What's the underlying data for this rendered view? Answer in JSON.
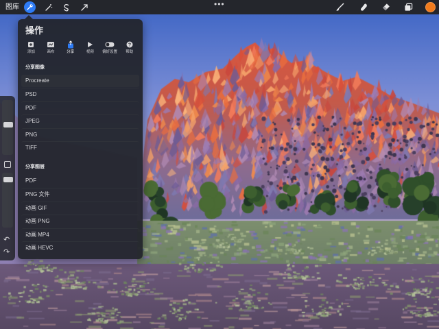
{
  "toolbar": {
    "gallery_label": "图库",
    "left_tools": [
      {
        "icon": "wrench-icon",
        "active": true
      },
      {
        "icon": "magic-wand-icon",
        "active": false
      },
      {
        "icon": "selection-icon",
        "active": false
      },
      {
        "icon": "transform-arrow-icon",
        "active": false
      }
    ],
    "more_label": "•••",
    "right_tools": [
      "brush-icon",
      "smudge-icon",
      "eraser-icon",
      "layers-icon"
    ],
    "current_color": "#f27b1c",
    "accent": "#2e7cf6"
  },
  "panel": {
    "title": "操作",
    "tabs": [
      {
        "label": "添加",
        "icon": "add-icon"
      },
      {
        "label": "画布",
        "icon": "canvas-icon"
      },
      {
        "label": "分享",
        "icon": "share-icon",
        "active": true
      },
      {
        "label": "视频",
        "icon": "video-icon"
      },
      {
        "label": "偏好设置",
        "icon": "toggle-icon"
      },
      {
        "label": "帮助",
        "icon": "help-icon"
      }
    ],
    "share_image_header": "分享图像",
    "share_image_items": [
      "Procreate",
      "PSD",
      "PDF",
      "JPEG",
      "PNG",
      "TIFF"
    ],
    "share_layers_header": "分享图层",
    "share_layers_items": [
      "PDF",
      "PNG 文件",
      "动画 GIF",
      "动画 PNG",
      "动画 MP4",
      "动画 HEVC"
    ]
  }
}
